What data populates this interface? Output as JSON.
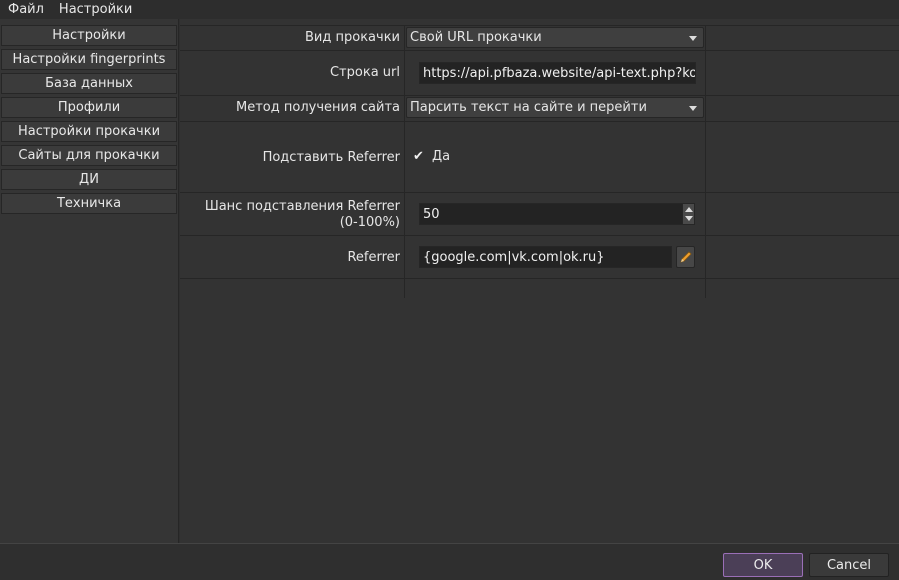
{
  "menu": {
    "file": "Файл",
    "settings": "Настройки"
  },
  "sidebar": {
    "items": [
      "Настройки",
      "Настройки fingerprints",
      "База данных",
      "Профили",
      "Настройки прокачки",
      "Сайты для прокачки",
      "ДИ",
      "Техничка"
    ]
  },
  "form": {
    "pump_type": {
      "label": "Вид прокачки",
      "value": "Свой URL прокачки"
    },
    "url_string": {
      "label": "Строка url",
      "value": "https://api.pfbaza.website/api-text.php?kod=eS"
    },
    "site_method": {
      "label": "Метод получения сайта",
      "value": "Парсить текст на сайте и перейти"
    },
    "substitute_referrer": {
      "label": "Подставить Referrer",
      "checked_mark": "✔",
      "check_label": "Да"
    },
    "referrer_chance": {
      "label_line1": "Шанс подставления Referrer",
      "label_line2": "(0-100%)",
      "value": "50"
    },
    "referrer": {
      "label": "Referrer",
      "value": "{google.com|vk.com|ok.ru}"
    }
  },
  "footer": {
    "ok": "OK",
    "cancel": "Cancel"
  },
  "colors": {
    "ok_border": "#9a6fb7",
    "background": "#2f2f2f",
    "accent_pencil": "#f0a030"
  },
  "icons": [
    "dropdown-arrow-icon",
    "checkmark-icon",
    "spinner-up-icon",
    "spinner-down-icon",
    "pencil-icon"
  ]
}
